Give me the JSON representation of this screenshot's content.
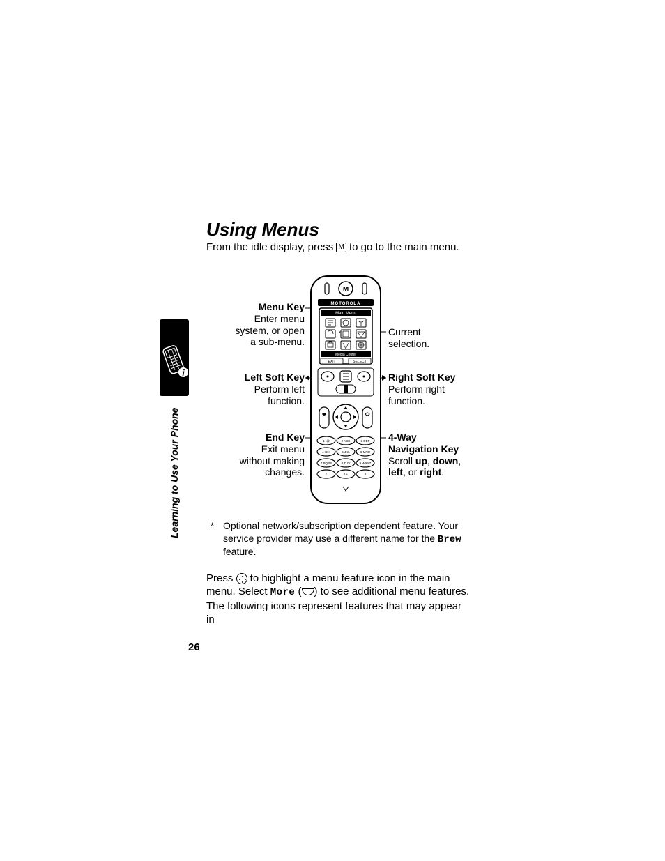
{
  "heading": "Using Menus",
  "intro_pre": "From the idle display, press ",
  "intro_post": " to go to the main menu.",
  "menu_glyph": "M",
  "sidebar_label": "Learning to Use Your Phone",
  "phone": {
    "brand": "MOTOROLA",
    "screen_title": "Main Menu",
    "screen_footer": "Media Center",
    "soft_left": "EXIT",
    "soft_right": "SELECT",
    "keypad": [
      "1 .@",
      "2 ABC",
      "3 DEF",
      "4 GHI",
      "5 JKL",
      "6 MNO",
      "7 PQRS",
      "8 TUV",
      "9 WXYZ",
      "*",
      "0 +",
      "#"
    ]
  },
  "callouts": {
    "menu_key": {
      "title": "Menu Key",
      "l1": "Enter menu",
      "l2": "system, or open",
      "l3": "a sub-menu."
    },
    "current": {
      "l1": "Current",
      "l2": "selection."
    },
    "left_soft": {
      "title": "Left Soft Key",
      "l1": "Perform left",
      "l2": "function."
    },
    "right_soft": {
      "title": "Right Soft Key",
      "l1": "Perform right",
      "l2": "function."
    },
    "end_key": {
      "title": "End Key",
      "l1": "Exit menu",
      "l2": "without making",
      "l3": "changes."
    },
    "nav_key": {
      "title": "4-Way",
      "title2": "Navigation Key",
      "l1_pre": "Scroll ",
      "l1_b1": "up",
      "l1_mid": ", ",
      "l1_b2": "down",
      "l1_post": ",",
      "l2_b1": "left",
      "l2_mid": ", or ",
      "l2_b2": "right",
      "l2_post": "."
    }
  },
  "footnote": {
    "ast": "*",
    "l1": "Optional network/subscription dependent feature. Your",
    "l2_pre": "service provider may use a different name for the ",
    "l2_brew": "Brew",
    "l3": "feature."
  },
  "para2": {
    "l1_pre": "Press ",
    "l1_post": " to highlight a menu feature icon in the main",
    "l2_pre": "menu. Select ",
    "l2_more": "More",
    "l2_mid": " (",
    "l2_post": ") to see additional menu features.",
    "l3": "The following icons represent features that may appear in"
  },
  "page_number": "26"
}
